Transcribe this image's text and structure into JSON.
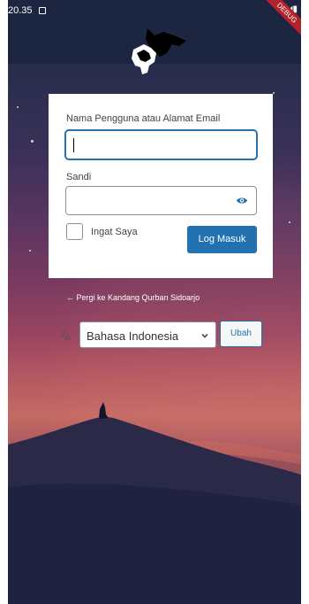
{
  "status_bar": {
    "time": "20.35",
    "debug_label": "DEBUG"
  },
  "login_form": {
    "username_label": "Nama Pengguna atau Alamat Email",
    "username_value": "",
    "password_label": "Sandi",
    "password_value": "",
    "remember_label": "Ingat Saya",
    "remember_checked": false,
    "submit_label": "Log Masuk"
  },
  "back_link": "← Pergi ke Kandang Qurban Sidoarjo",
  "language": {
    "selected": "Bahasa Indonesia",
    "change_label": "Ubah"
  },
  "colors": {
    "accent": "#2271b1",
    "card": "#ffffff",
    "sky_top": "#1e2744",
    "sky_glow": "#c46a63"
  }
}
